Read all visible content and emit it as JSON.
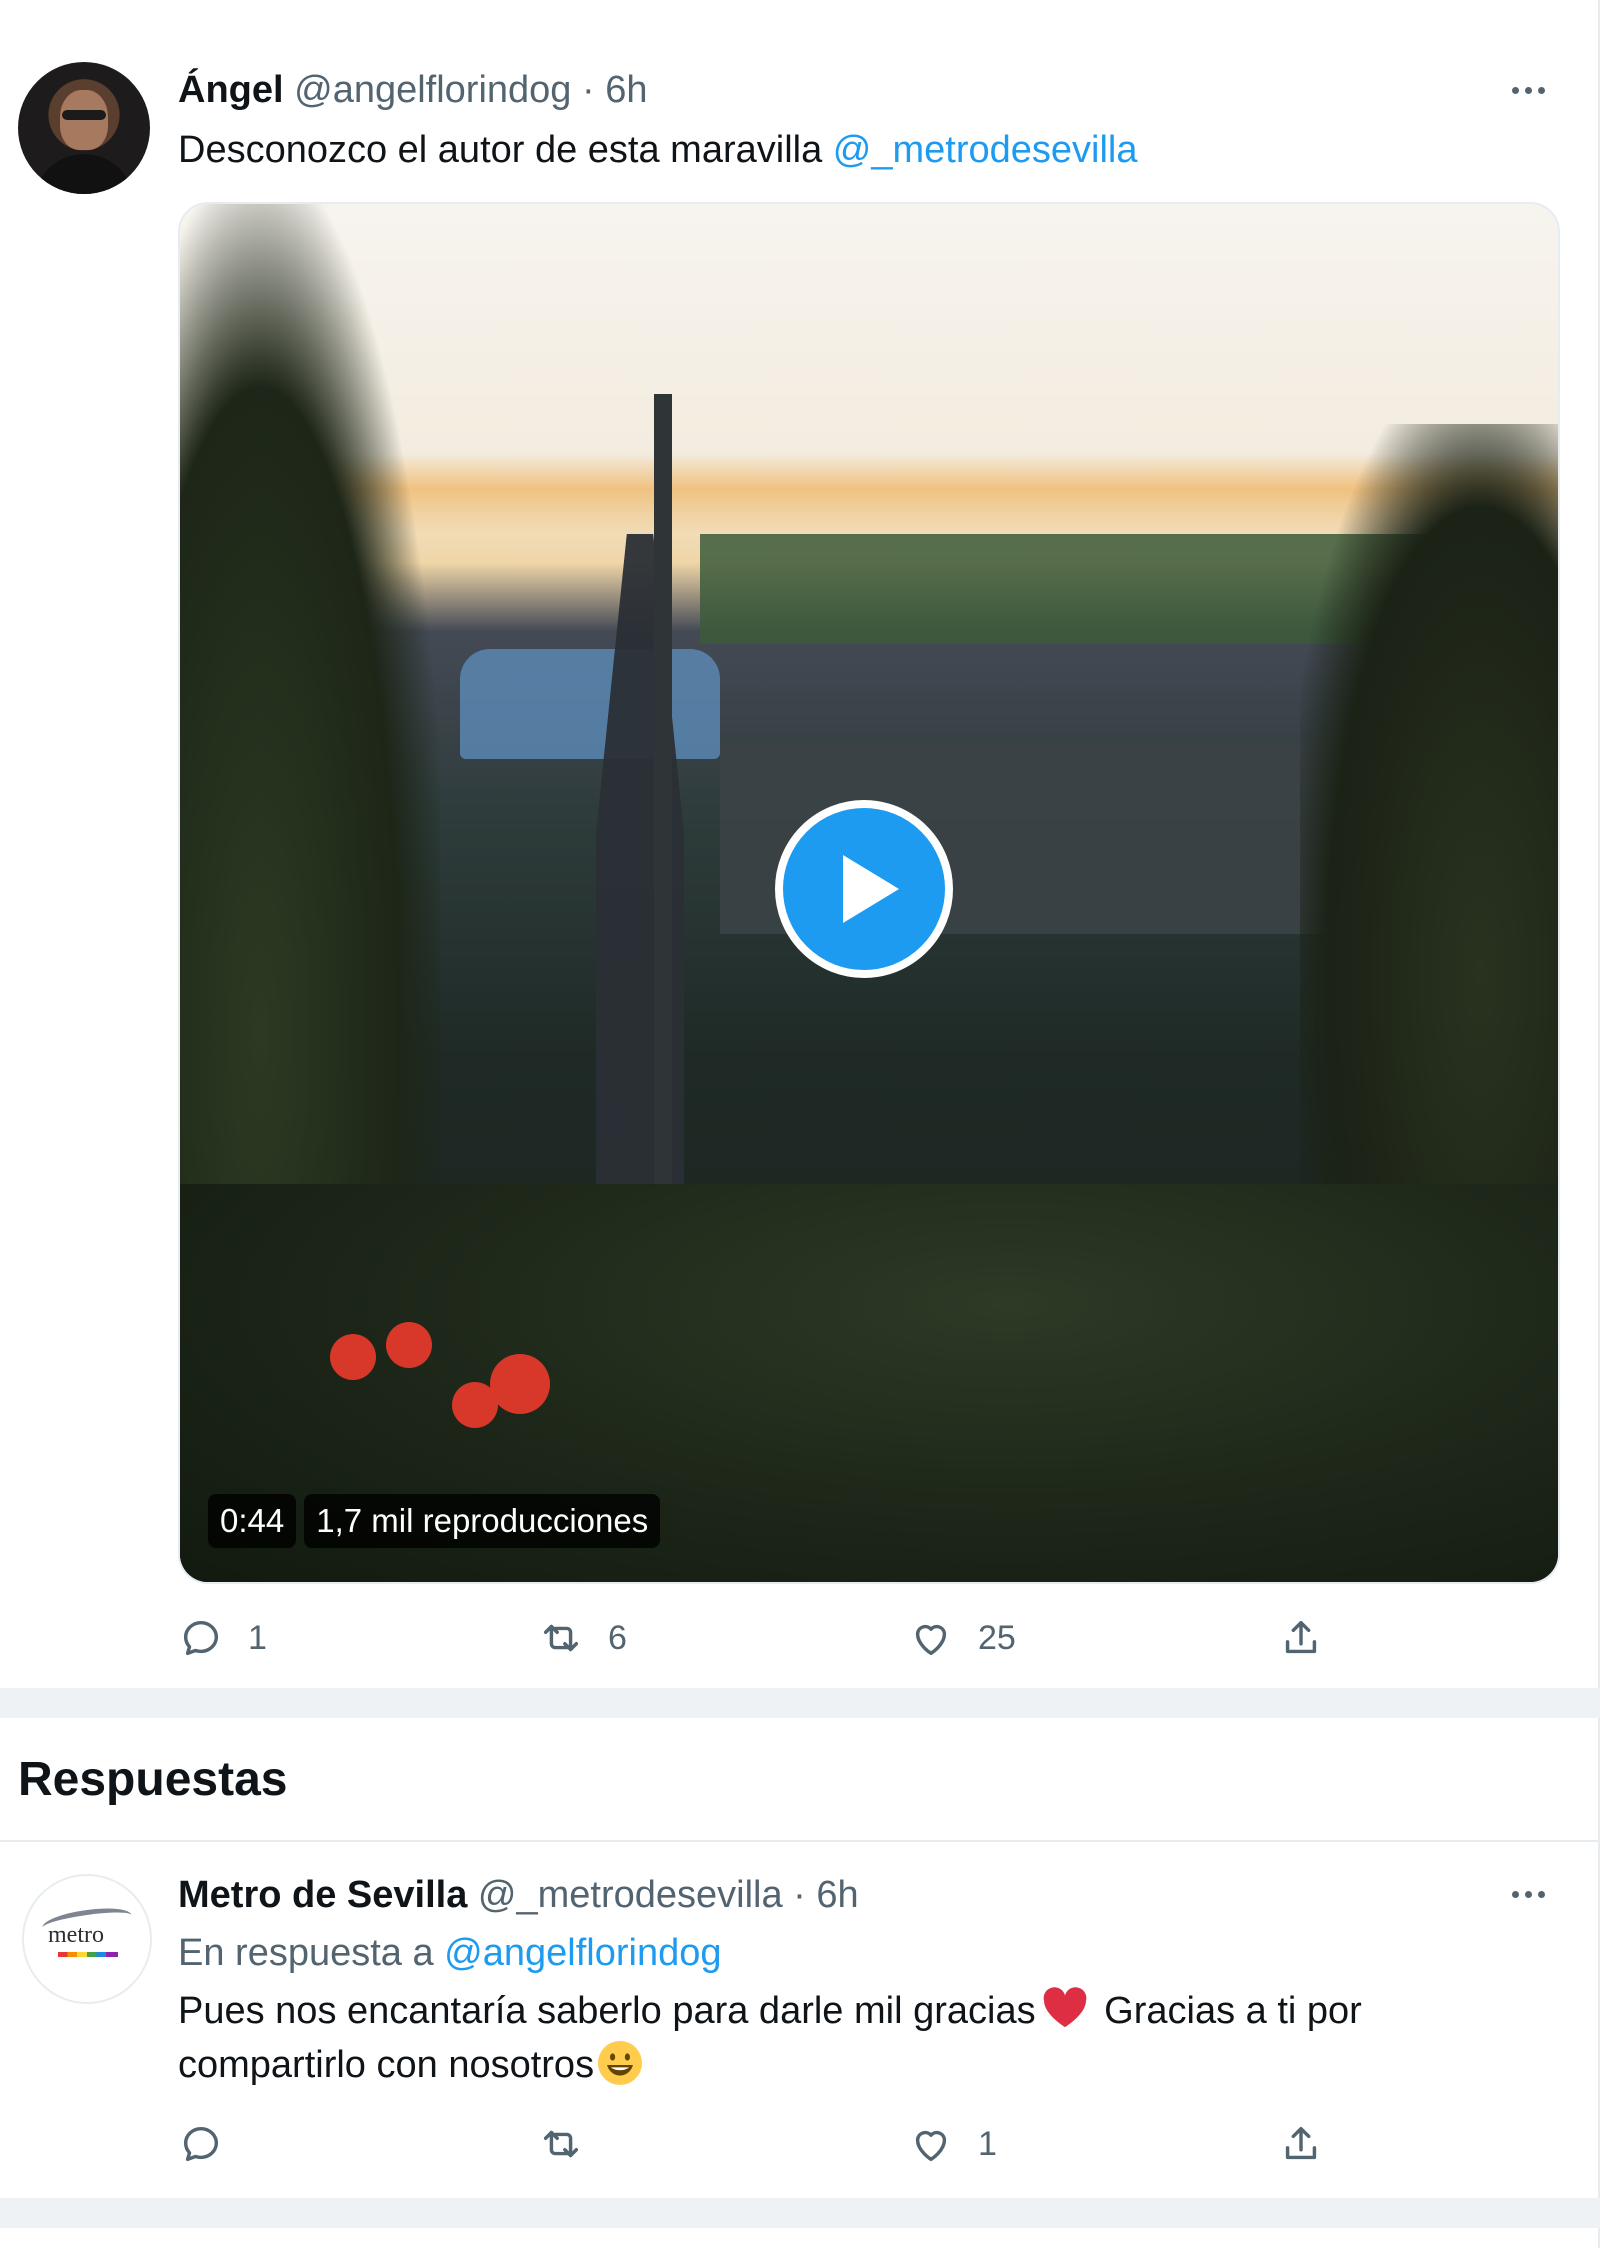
{
  "tweet": {
    "author": "Ángel",
    "handle": "@angelflorindog",
    "dot": "·",
    "time": "6h",
    "text_before": "Desconozco el autor de esta maravilla ",
    "mention": "@_metrodesevilla",
    "video": {
      "duration": "0:44",
      "views": "1,7 mil reproducciones"
    },
    "stats": {
      "replies": "1",
      "retweets": "6",
      "likes": "25"
    }
  },
  "section_title": "Respuestas",
  "reply": {
    "author": "Metro de Sevilla",
    "handle": "@_metrodesevilla",
    "dot": "·",
    "time": "6h",
    "in_reply_prefix": "En respuesta a ",
    "in_reply_handle": "@angelflorindog",
    "text_part1": "Pues nos encantaría saberlo para darle mil gracias",
    "text_part2": " Gracias a ti por compartirlo con nosotros",
    "avatar_logo_text": "metro",
    "stats": {
      "likes": "1"
    }
  },
  "colors": {
    "accent": "#1d9bf0",
    "muted": "#536471",
    "text": "#0f1419",
    "heart": "#e0245e"
  }
}
